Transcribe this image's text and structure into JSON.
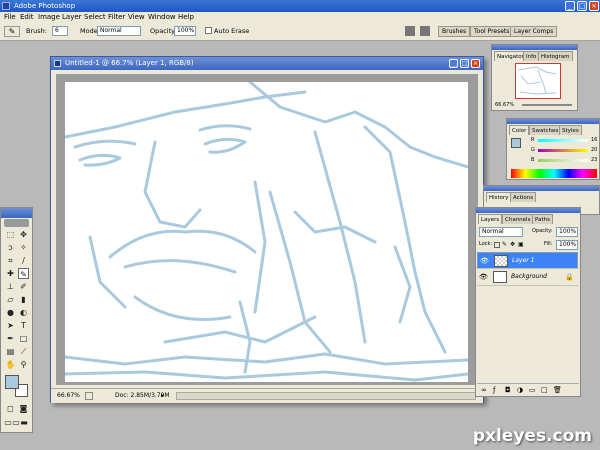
{
  "app": {
    "title": "Adobe Photoshop",
    "window_controls": {
      "minimize": "_",
      "maximize": "□",
      "close": "×"
    }
  },
  "menu": [
    "File",
    "Edit",
    "Image",
    "Layer",
    "Select",
    "Filter",
    "View",
    "Window",
    "Help"
  ],
  "options_bar": {
    "brush_label": "Brush:",
    "brush_size": "6",
    "mode_label": "Mode:",
    "mode_value": "Normal",
    "opacity_label": "Opacity:",
    "opacity_value": "100%",
    "auto_erase_label": "Auto Erase",
    "well_tabs": [
      "Brushes",
      "Tool Presets",
      "Layer Comps"
    ]
  },
  "document": {
    "title": "Untitled-1 @ 66.7% (Layer 1, RGB/8)",
    "zoom": "66.67%",
    "doc_size": "Doc: 2.85M/3.79M"
  },
  "navigator": {
    "tabs": [
      "Navigator",
      "Info",
      "Histogram"
    ],
    "zoom": "66.67%"
  },
  "color_panel": {
    "tabs": [
      "Color",
      "Swatches",
      "Styles"
    ],
    "channels": [
      {
        "label": "R",
        "value": "16"
      },
      {
        "label": "G",
        "value": "20"
      },
      {
        "label": "B",
        "value": "23"
      }
    ],
    "foreground_color": "#a9c9df"
  },
  "history_panel": {
    "tabs": [
      "History",
      "Actions"
    ]
  },
  "layers_panel": {
    "tabs": [
      "Layers",
      "Channels",
      "Paths"
    ],
    "blend_mode": "Normal",
    "opacity_label": "Opacity:",
    "opacity_value": "100%",
    "lock_label": "Lock:",
    "fill_label": "Fill:",
    "fill_value": "100%",
    "layers": [
      {
        "name": "Layer 1",
        "selected": true
      },
      {
        "name": "Background",
        "selected": false
      }
    ]
  },
  "watermark": "pxleyes.com",
  "colors": {
    "stroke": "#a9c9df",
    "selection": "#3d83f5",
    "workspace": "#b9b9b9"
  }
}
